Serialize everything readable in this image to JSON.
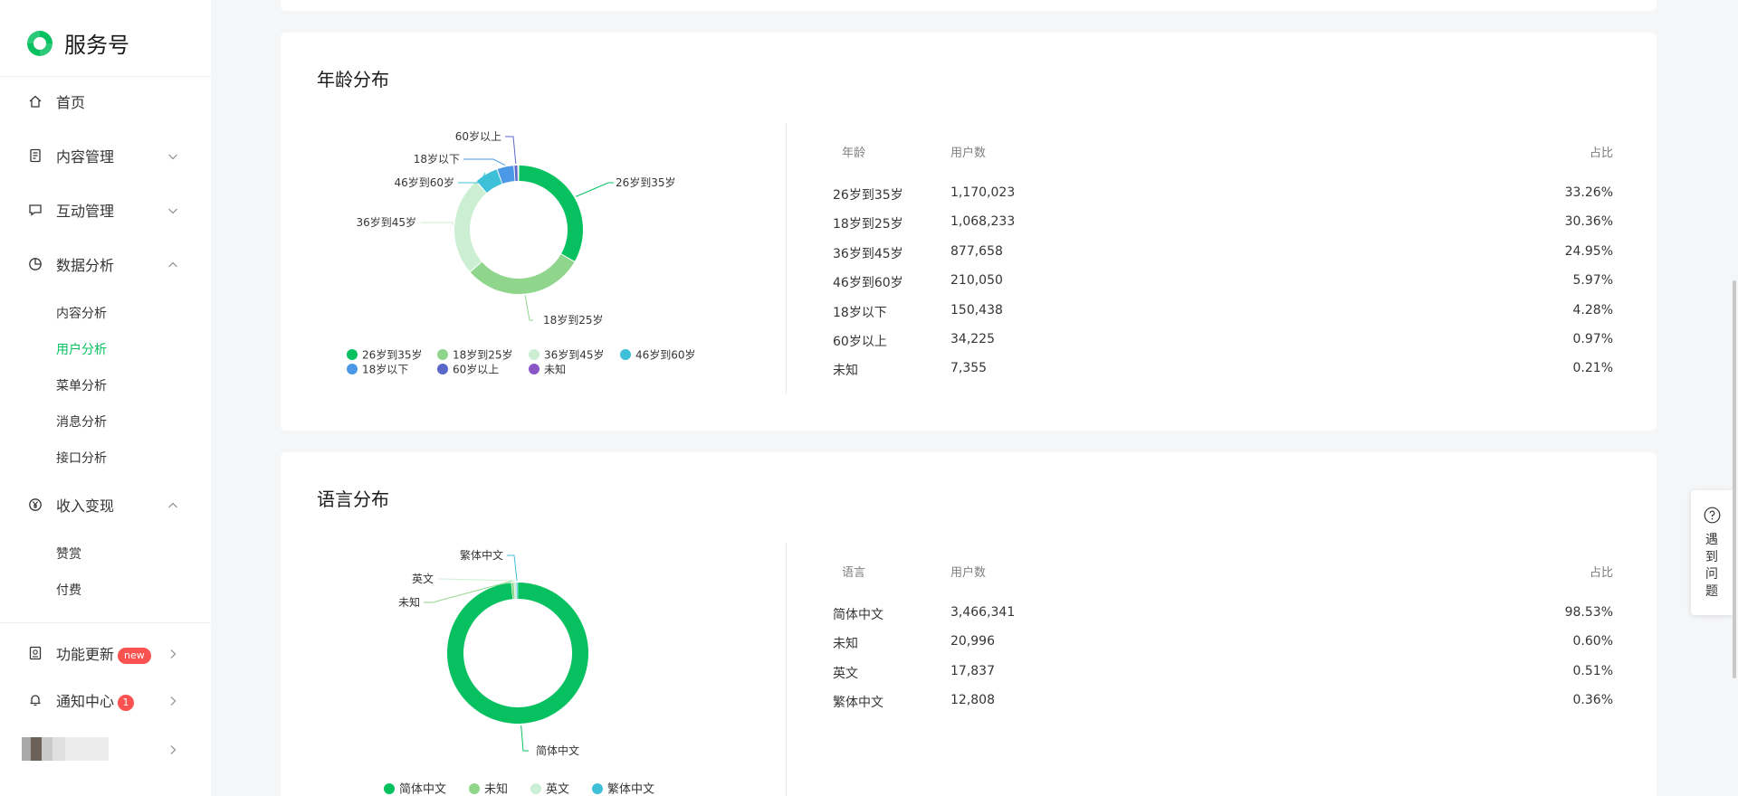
{
  "app": {
    "title": "服务号"
  },
  "sidebar": {
    "items": [
      {
        "label": "首页",
        "icon": "home-icon"
      },
      {
        "label": "内容管理",
        "icon": "document-icon"
      },
      {
        "label": "互动管理",
        "icon": "comment-icon"
      },
      {
        "label": "数据分析",
        "icon": "pie-chart-icon"
      },
      {
        "label": "收入变现",
        "icon": "yen-icon"
      }
    ],
    "data_sub": [
      "内容分析",
      "用户分析",
      "菜单分析",
      "消息分析",
      "接口分析"
    ],
    "income_sub": [
      "赞赏",
      "付费"
    ],
    "bottom": [
      {
        "label": "功能更新",
        "badge": "new",
        "icon": "update-icon"
      },
      {
        "label": "通知中心",
        "badge": "1",
        "icon": "bell-icon"
      }
    ]
  },
  "age": {
    "title": "年龄分布",
    "headers": [
      "年龄",
      "用户数",
      "占比"
    ],
    "rows": [
      [
        "26岁到35岁",
        "1,170,023",
        "33.26%"
      ],
      [
        "18岁到25岁",
        "1,068,233",
        "30.36%"
      ],
      [
        "36岁到45岁",
        "877,658",
        "24.95%"
      ],
      [
        "46岁到60岁",
        "210,050",
        "5.97%"
      ],
      [
        "18岁以下",
        "150,438",
        "4.28%"
      ],
      [
        "60岁以上",
        "34,225",
        "0.97%"
      ],
      [
        "未知",
        "7,355",
        "0.21%"
      ]
    ],
    "legend": [
      "26岁到35岁",
      "18岁到25岁",
      "36岁到45岁",
      "46岁到60岁",
      "18岁以下",
      "60岁以上",
      "未知"
    ],
    "colors": [
      "#07c160",
      "#8fd68c",
      "#ccefd4",
      "#3fc0d9",
      "#4b99e6",
      "#5b68c9",
      "#8a58c6"
    ]
  },
  "language": {
    "title": "语言分布",
    "headers": [
      "语言",
      "用户数",
      "占比"
    ],
    "rows": [
      [
        "简体中文",
        "3,466,341",
        "98.53%"
      ],
      [
        "未知",
        "20,996",
        "0.60%"
      ],
      [
        "英文",
        "17,837",
        "0.51%"
      ],
      [
        "繁体中文",
        "12,808",
        "0.36%"
      ]
    ],
    "legend": [
      "简体中文",
      "未知",
      "英文",
      "繁体中文"
    ],
    "colors": [
      "#07c160",
      "#8fd68c",
      "#ccefd4",
      "#3fc0d9"
    ]
  },
  "help": {
    "label": "遇到问题"
  },
  "chart_data": [
    {
      "type": "pie",
      "categories": [
        "26岁到35岁",
        "18岁到25岁",
        "36岁到45岁",
        "46岁到60岁",
        "18岁以下",
        "60岁以上",
        "未知"
      ],
      "values": [
        33.26,
        30.36,
        24.95,
        5.97,
        4.28,
        0.97,
        0.21
      ]
    },
    {
      "type": "pie",
      "categories": [
        "简体中文",
        "未知",
        "英文",
        "繁体中文"
      ],
      "values": [
        98.53,
        0.6,
        0.51,
        0.36
      ]
    }
  ]
}
